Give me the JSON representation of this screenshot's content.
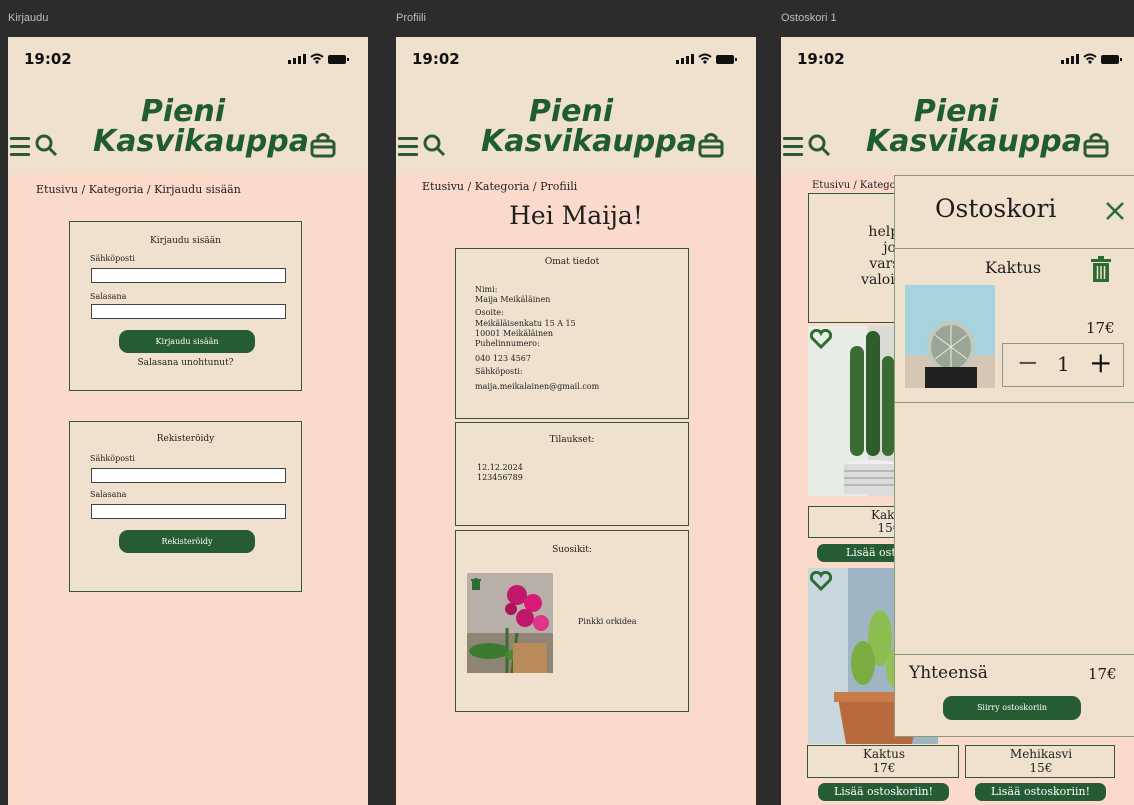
{
  "frames": {
    "login": "Kirjaudu",
    "profile": "Profiili",
    "cart": "Ostoskori 1"
  },
  "status": {
    "time": "19:02"
  },
  "brand": {
    "line1": "Pieni",
    "line2": "Kasvikauppa"
  },
  "login": {
    "breadcrumb": "Etusivu / Kategoria / Kirjaudu sisään",
    "login_box": {
      "title": "Kirjaudu sisään",
      "email_label": "Sähköposti",
      "email_value": "",
      "password_label": "Salasana",
      "password_value": "",
      "submit": "Kirjaudu sisään",
      "forgot": "Salasana unohtunut?"
    },
    "register_box": {
      "title": "Rekisteröidy",
      "email_label": "Sähköposti",
      "email_value": "",
      "password_label": "Salasana",
      "password_value": "",
      "submit": "Rekisteröidy"
    }
  },
  "profile": {
    "breadcrumb": "Etusivu / Kategoria / Profiili",
    "greeting": "Hei Maija!",
    "info": {
      "title": "Omat tiedot",
      "name_label": "Nimi:",
      "name": "Maija Meikäläinen",
      "address_label": "Osoite:",
      "address_line1": "Meikäläisenkatu 15 A 15",
      "address_line2": "10001 Meikäläinen",
      "phone_label": "Puhelinnumero:",
      "phone": "040 123 4567",
      "email_label": "Sähköposti:",
      "email": "maija.meikalainen@gmail.com"
    },
    "orders": {
      "title": "Tilaukset:",
      "date": "12.12.2024",
      "number": "123456789"
    },
    "favorites": {
      "title": "Suosikit:",
      "item": "Pinkki orkidea"
    }
  },
  "cart": {
    "breadcrumb": "Etusivu / Katego",
    "promo_lines": [
      "Meh",
      "helppoh",
      "jotka v",
      "varsiins",
      "valoisassa"
    ],
    "products": [
      {
        "name": "Kaktu",
        "price": "15€"
      },
      {
        "name": "Kaktus",
        "price": "17€"
      },
      {
        "name": "Mehikasvi",
        "price": "15€"
      }
    ],
    "add_cut": "Lisää ostos",
    "add_button": "Lisää ostoskoriin!",
    "drawer": {
      "title": "Ostoskori",
      "item_name": "Kaktus",
      "item_price": "17€",
      "quantity": "1",
      "minus": "−",
      "plus": "+",
      "total_label": "Yhteensä",
      "total_value": "17€",
      "checkout": "Siirry ostoskoriin"
    }
  },
  "colors": {
    "header": "#efe1cd",
    "page": "#fcdacb",
    "brand_green": "#1f5e2c",
    "button_green": "#255c33"
  }
}
